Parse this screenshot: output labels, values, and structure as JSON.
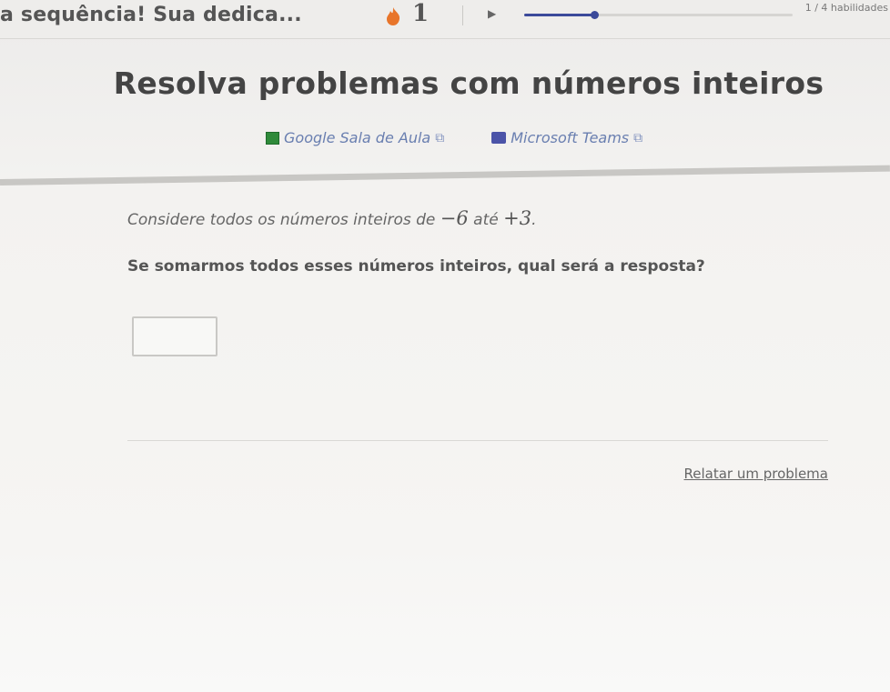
{
  "topbar": {
    "streak_message": "a sequência! Sua dedica...",
    "streak_count": "1",
    "level_progress": 0.26,
    "skills_label": "1 / 4 habilidades"
  },
  "header": {
    "title": "Resolva problemas com números inteiros",
    "links": [
      {
        "label": "Google Sala de Aula",
        "icon": "google-classroom-icon",
        "color": "#2f8a3a"
      },
      {
        "label": "Microsoft Teams",
        "icon": "microsoft-teams-icon",
        "color": "#4b53a8"
      }
    ]
  },
  "question": {
    "intro_text": "Considere todos os números inteiros de",
    "start_value": "−6",
    "middle_text": "até",
    "end_value": "+3",
    "end_punct": ".",
    "prompt": "Se somarmos todos esses números inteiros, qual será a resposta?",
    "answer_value": ""
  },
  "footer": {
    "report_label": "Relatar um problema"
  },
  "colors": {
    "accent": "#3b4a9a",
    "link": "#6a7fb0",
    "flame": "#e8752a"
  }
}
